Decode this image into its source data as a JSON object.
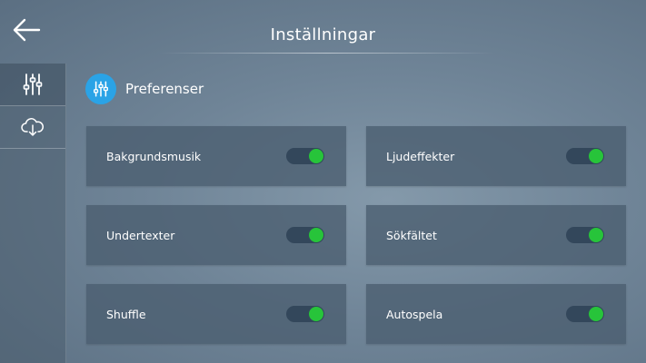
{
  "header": {
    "title": "Inställningar"
  },
  "sidebar": {
    "items": [
      {
        "icon": "sliders-icon",
        "active": true
      },
      {
        "icon": "cloud-download-icon",
        "active": false
      }
    ]
  },
  "section": {
    "title": "Preferenser",
    "icon": "sliders-icon"
  },
  "settings": [
    {
      "label": "Bakgrundsmusik",
      "enabled": true
    },
    {
      "label": "Ljudeffekter",
      "enabled": true
    },
    {
      "label": "Undertexter",
      "enabled": true
    },
    {
      "label": "Sökfältet",
      "enabled": true
    },
    {
      "label": "Shuffle",
      "enabled": true
    },
    {
      "label": "Autospela",
      "enabled": true
    }
  ],
  "colors": {
    "accent": "#2aa3e6",
    "toggle_on": "#27c43a",
    "toggle_track": "#33475b"
  }
}
